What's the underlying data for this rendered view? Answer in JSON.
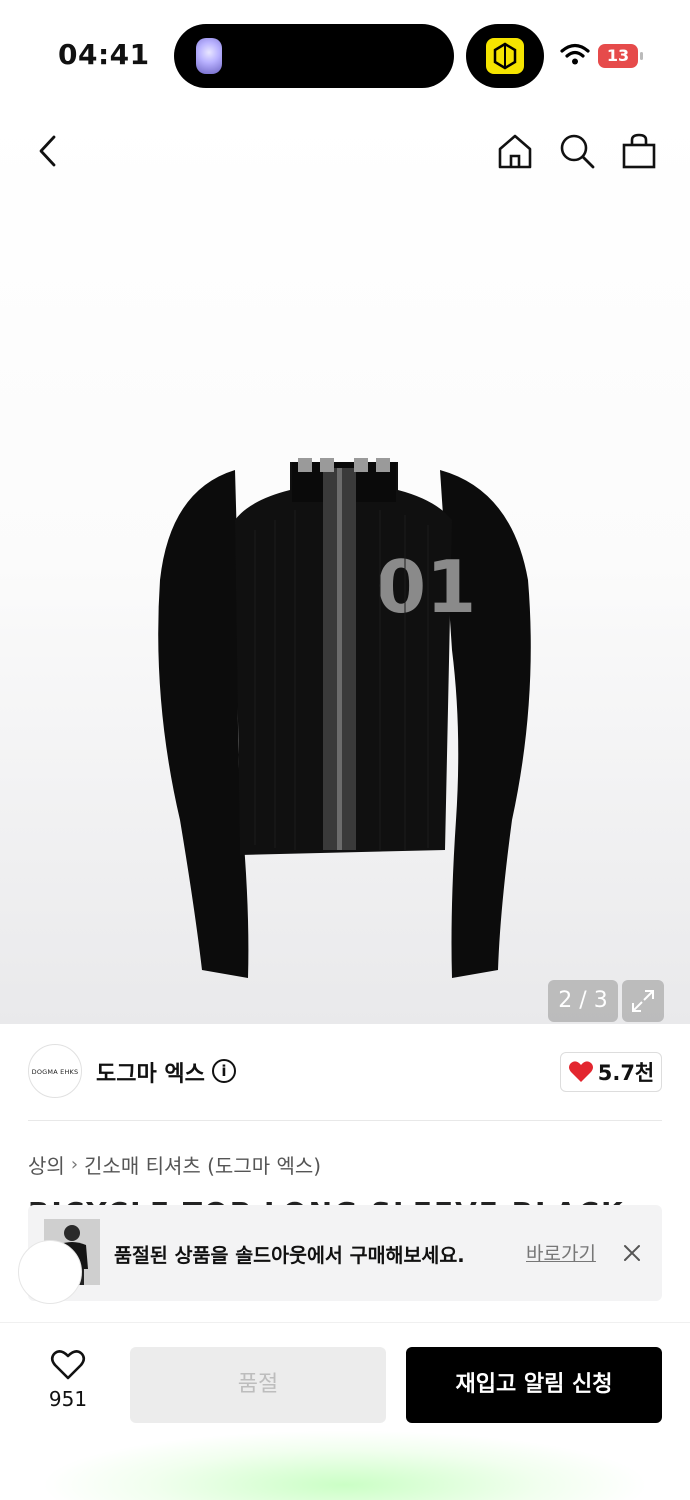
{
  "status_bar": {
    "time": "04:41",
    "battery": "13"
  },
  "image_viewer": {
    "pager": "2 / 3",
    "garment_print": "01"
  },
  "brand": {
    "logo_text": "DOGMA EHKS",
    "name": "도그마 엑스",
    "likes": "5.7천"
  },
  "breadcrumb": {
    "category": "상의",
    "subcategory": "긴소매 티셔츠 (도그마 엑스)"
  },
  "product": {
    "title": "BICYCLE TOP LONG SLEEVE BLACK"
  },
  "banner": {
    "message": "품절된 상품을 솔드아웃에서 구매해보세요.",
    "link": "바로가기"
  },
  "bottom_bar": {
    "wish_count": "951",
    "soldout_label": "품절",
    "restock_label": "재입고 알림 신청"
  },
  "colors": {
    "like_red": "#e3262f",
    "primary": "#000000",
    "disabled": "#ececec"
  },
  "icons": [
    "back-icon",
    "home-icon",
    "search-icon",
    "bag-icon",
    "expand-icon",
    "info-icon",
    "heart-icon",
    "close-icon"
  ]
}
